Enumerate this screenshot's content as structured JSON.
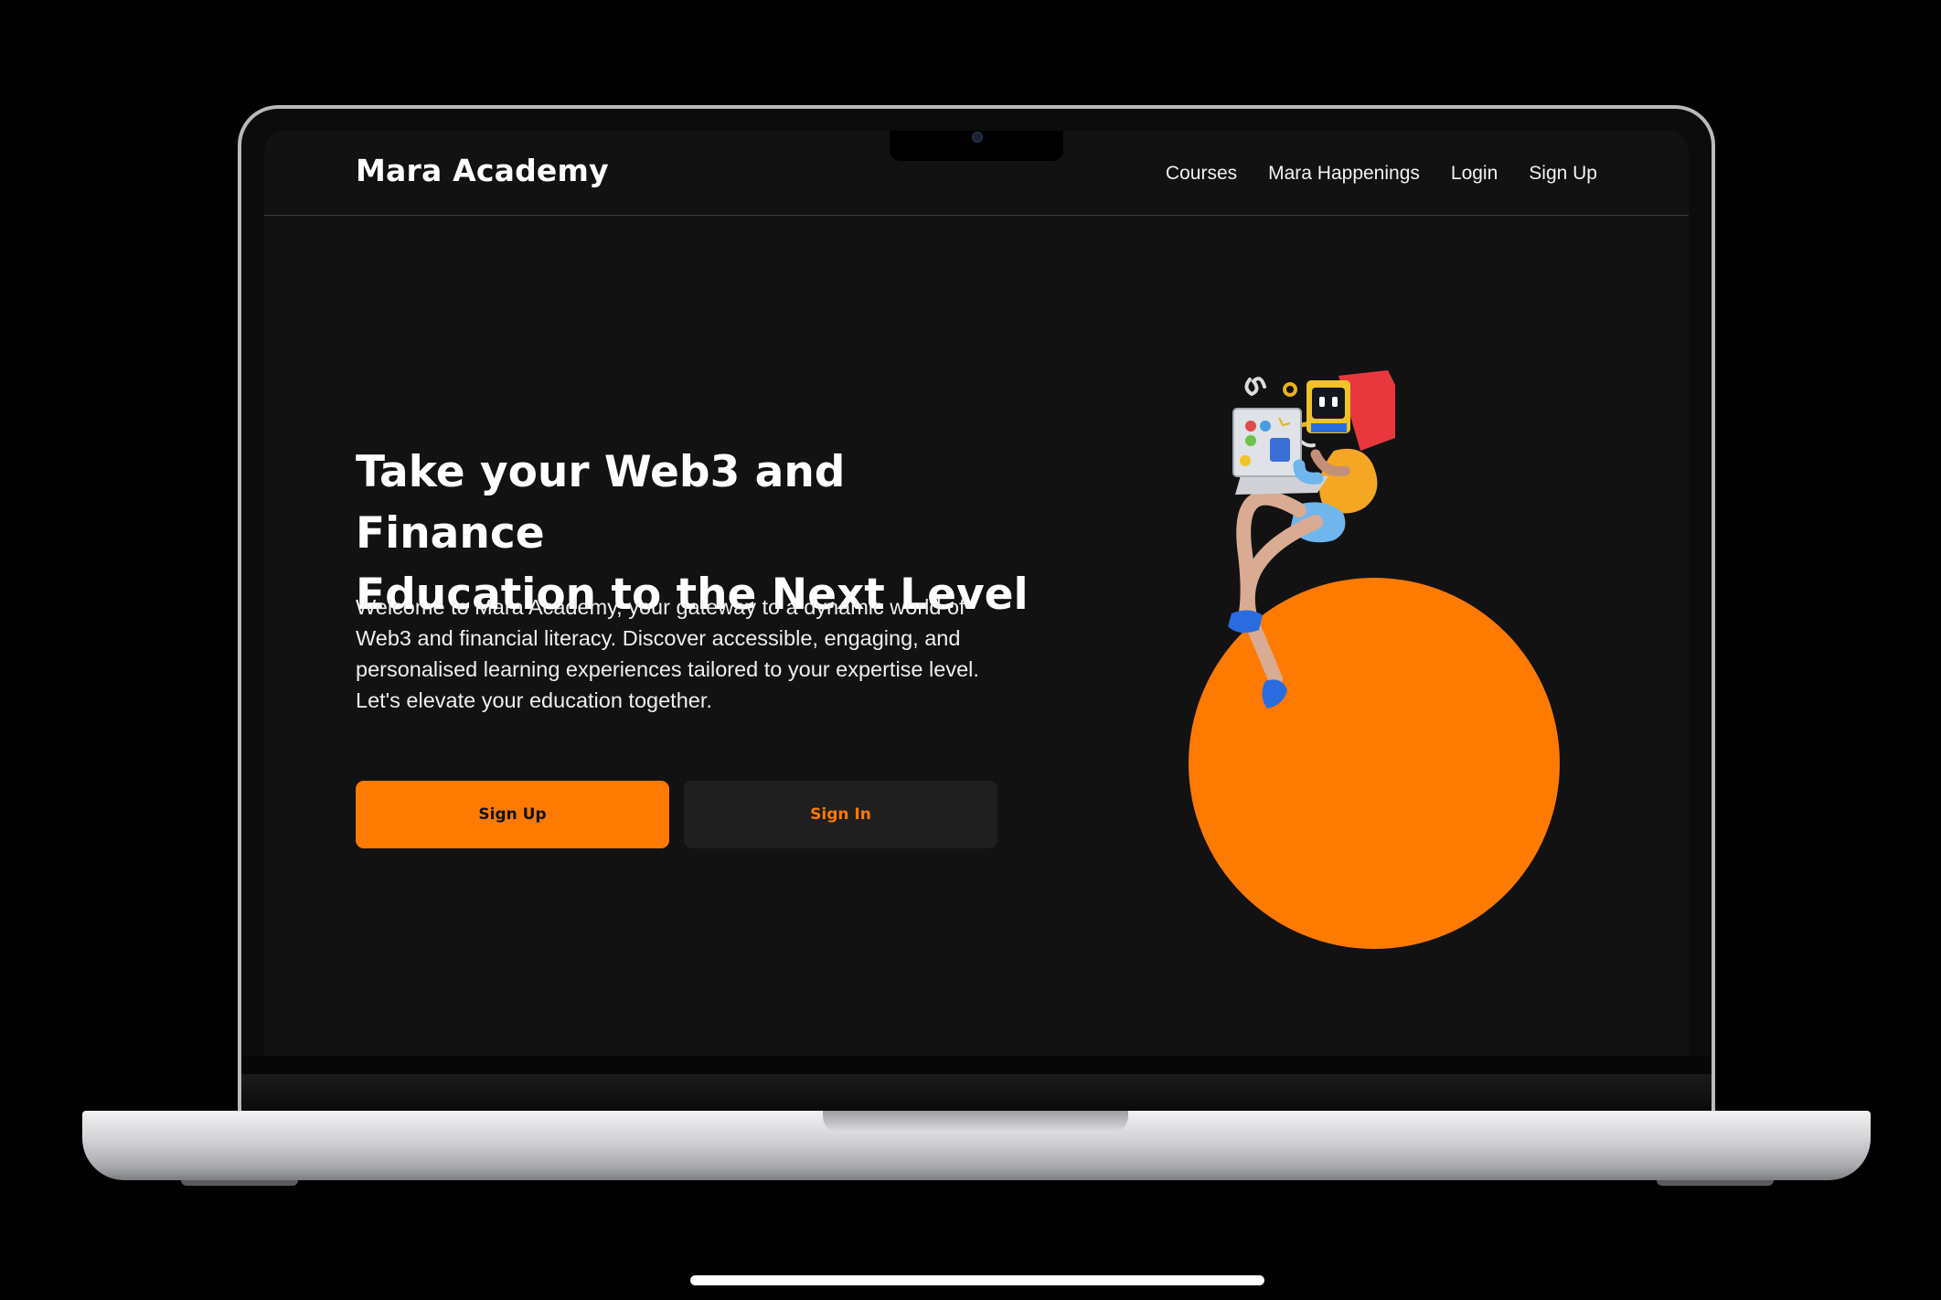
{
  "nav": {
    "brand": "Mara Academy",
    "links": [
      "Courses",
      "Mara Happenings",
      "Login",
      "Sign Up"
    ]
  },
  "hero": {
    "headline_line1": "Take your Web3 and Finance",
    "headline_line2": "Education to the Next Level",
    "lead": "Welcome to Mara Academy, your gateway to a dynamic world of Web3 and financial literacy. Discover accessible, engaging, and personalised learning experiences tailored to your expertise level. Let's elevate your education together.",
    "primary_button": "Sign Up",
    "secondary_button": "Sign In"
  },
  "colors": {
    "accent": "#ff7a00",
    "background": "#121212",
    "secondary_button_bg": "#1f1f1f"
  },
  "illustration": {
    "icon": "character-with-laptop-illustration"
  }
}
